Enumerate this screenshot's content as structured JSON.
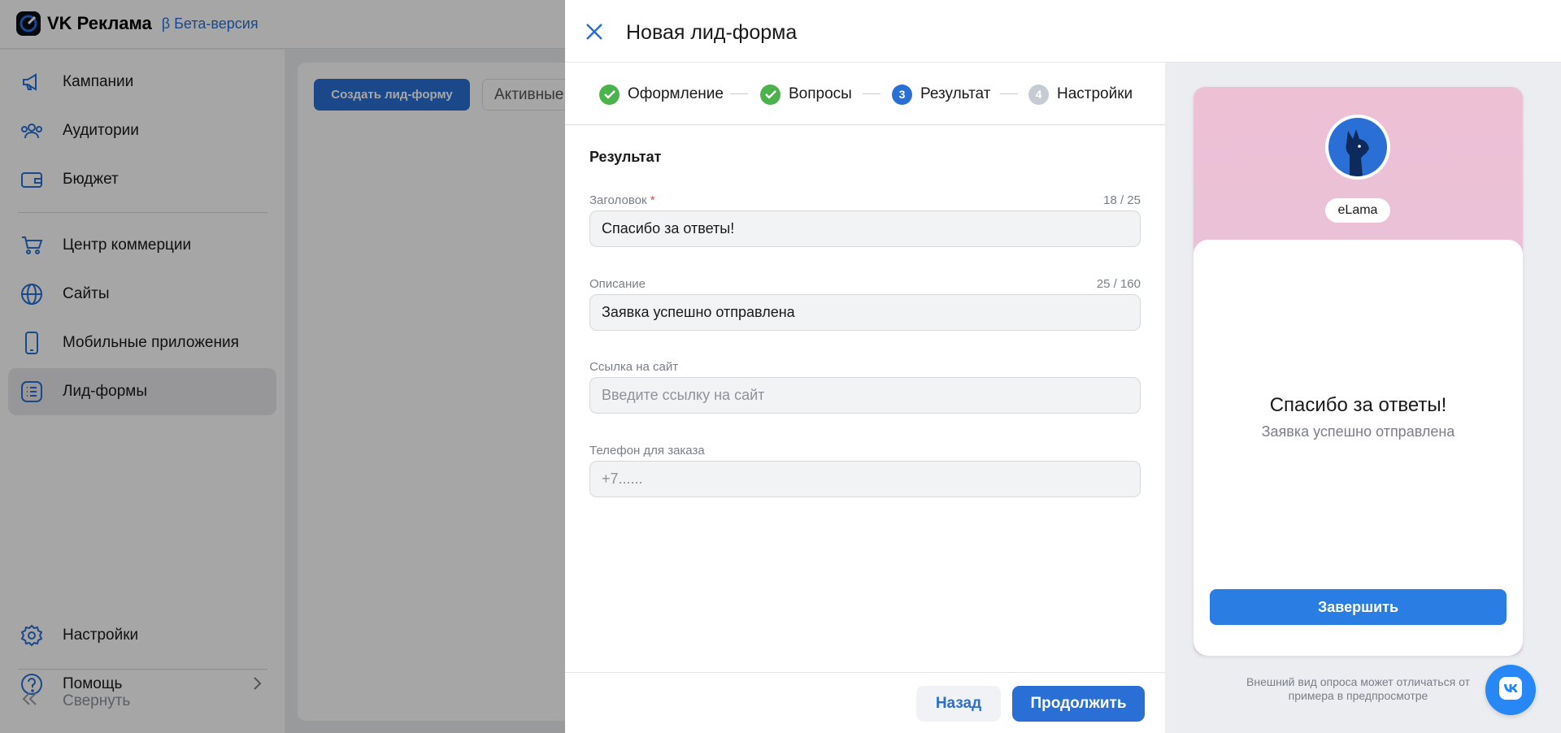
{
  "app": {
    "logo_text": "VK Реклама",
    "beta_label": "β Бета-версия"
  },
  "sidebar": {
    "items": [
      {
        "label": "Кампании",
        "icon": "megaphone-icon"
      },
      {
        "label": "Аудитории",
        "icon": "users-icon"
      },
      {
        "label": "Бюджет",
        "icon": "wallet-icon"
      },
      {
        "label": "Центр коммерции",
        "icon": "cart-icon"
      },
      {
        "label": "Сайты",
        "icon": "globe-icon"
      },
      {
        "label": "Мобильные приложения",
        "icon": "phone-icon"
      },
      {
        "label": "Лид-формы",
        "icon": "list-icon",
        "active": true
      },
      {
        "label": "Настройки",
        "icon": "gear-icon"
      },
      {
        "label": "Помощь",
        "icon": "help-icon"
      }
    ],
    "collapse_label": "Свернуть"
  },
  "content": {
    "create_button": "Создать лид-форму",
    "filter_tab": "Активные"
  },
  "modal": {
    "title": "Новая лид-форма",
    "steps": [
      {
        "number": "1",
        "label": "Оформление",
        "state": "done"
      },
      {
        "number": "2",
        "label": "Вопросы",
        "state": "done"
      },
      {
        "number": "3",
        "label": "Результат",
        "state": "current"
      },
      {
        "number": "4",
        "label": "Настройки",
        "state": "todo"
      }
    ],
    "section_title": "Результат",
    "fields": {
      "headline": {
        "label": "Заголовок",
        "required_mark": "*",
        "counter": "18 / 25",
        "value": "Спасибо за ответы!"
      },
      "description": {
        "label": "Описание",
        "counter": "25 / 160",
        "value": "Заявка успешно отправлена"
      },
      "site_link": {
        "label": "Ссылка на сайт",
        "placeholder": "Введите ссылку на сайт"
      },
      "phone": {
        "label": "Телефон для заказа",
        "placeholder": "+7......"
      }
    },
    "back_button": "Назад",
    "next_button": "Продолжить"
  },
  "preview": {
    "brand_name": "eLama",
    "thanks_title": "Спасибо за ответы!",
    "thanks_desc": "Заявка успешно отправлена",
    "finish_button": "Завершить",
    "note": "Внешний вид опроса может отличаться от примера в предпросмотре"
  },
  "colors": {
    "accent": "#2a6fd6",
    "success": "#4bb34b",
    "vk_blue": "#2787f5"
  }
}
